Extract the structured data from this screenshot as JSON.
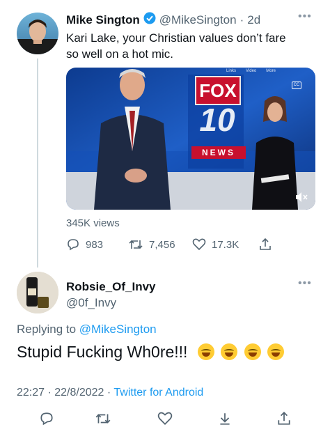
{
  "tweet": {
    "name": "Mike Sington",
    "handle": "@MikeSington",
    "dot": "·",
    "time": "2d",
    "text_line1": "Kari Lake, your Christian values don’t fare",
    "text_line2": "so well on a hot mic.",
    "views": "345K views",
    "replies": "983",
    "retweets": "7,456",
    "likes": "17.3K",
    "media": {
      "logo_top": "FOX",
      "logo_num": "10",
      "logo_bottom": "NEWS",
      "menu_items": [
        "Links",
        "Video",
        "More"
      ]
    }
  },
  "reply": {
    "name": "Robsie_Of_Invy",
    "handle": "@0f_Invy",
    "replying_prefix": "Replying to",
    "replying_handle": "@MikeSington",
    "text": "Stupid Fucking Wh0re!!!",
    "timestamp": "22:27 · 22/8/2022",
    "source_dot": "·",
    "source": "Twitter for Android"
  },
  "colors": {
    "link": "#1d9bf0",
    "muted": "#536471",
    "verified": "#1d9bf0"
  },
  "icons": [
    "verified-badge-icon",
    "more-icon",
    "reply-icon",
    "retweet-icon",
    "like-icon",
    "share-icon",
    "bookmark-icon",
    "mute-icon",
    "caption-icon",
    "emoji-rofl-icon"
  ]
}
